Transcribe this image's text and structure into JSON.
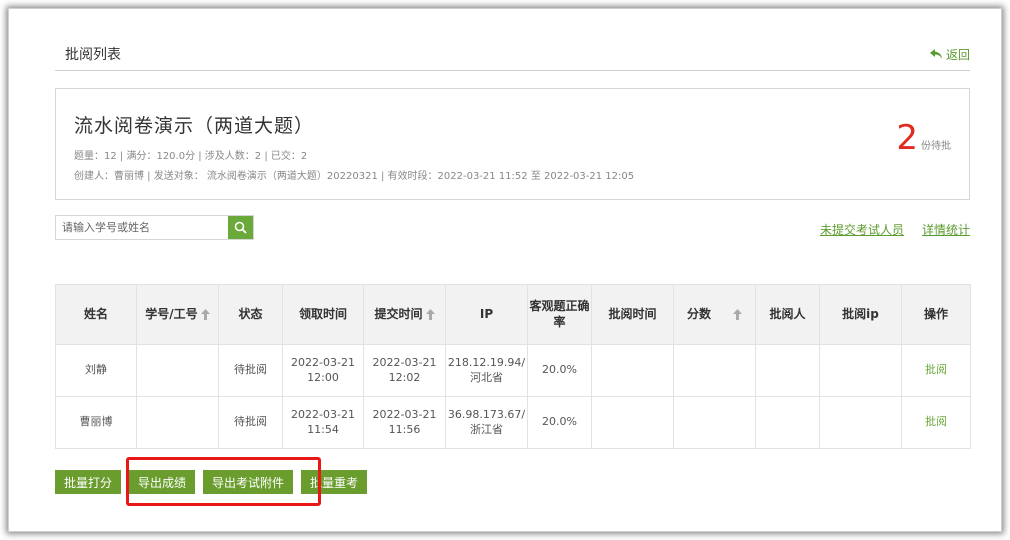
{
  "header": {
    "title": "批阅列表",
    "back_label": "返回"
  },
  "exam": {
    "title": "流水阅卷演示（两道大题）",
    "meta_line1": "题量：12 |  满分：120.0分 |  涉及人数：2 | 已交：2",
    "meta_line2": "创建人：曹丽博 | 发送对象：  流水阅卷演示（两道大题）20220321  |  有效时段：2022-03-21 11:52 至 2022-03-21 12:05",
    "pending_count": "2",
    "pending_label": "份待批"
  },
  "search": {
    "placeholder": "请输入学号或姓名"
  },
  "links": {
    "unsubmitted": "未提交考试人员",
    "details": "详情统计"
  },
  "table": {
    "headers": [
      "姓名",
      "学号/工号",
      "状态",
      "领取时间",
      "提交时间",
      "IP",
      "客观题正确率",
      "批阅时间",
      "分数",
      "批阅人",
      "批阅ip",
      "操作"
    ],
    "rows": [
      {
        "name": "刘静",
        "id": "",
        "status": "待批阅",
        "receive_date": "2022-03-21",
        "receive_time": "12:00",
        "submit_date": "2022-03-21",
        "submit_time": "12:02",
        "ip": "218.12.19.94/",
        "ip_region": "河北省",
        "accuracy": "20.0%",
        "review_time": "",
        "score": "",
        "reviewer": "",
        "reviewer_ip": "",
        "action": "批阅"
      },
      {
        "name": "曹丽博",
        "id": "",
        "status": "待批阅",
        "receive_date": "2022-03-21",
        "receive_time": "11:54",
        "submit_date": "2022-03-21",
        "submit_time": "11:56",
        "ip": "36.98.173.67/",
        "ip_region": "浙江省",
        "accuracy": "20.0%",
        "review_time": "",
        "score": "",
        "reviewer": "",
        "reviewer_ip": "",
        "action": "批阅"
      }
    ]
  },
  "actions": {
    "batch_score": "批量打分",
    "export_scores": "导出成绩",
    "export_attachments": "导出考试附件",
    "batch_retake": "批量重考"
  },
  "colors": {
    "accent_green": "#6a9d2e",
    "link_green": "#5a9b2e",
    "pending_red": "#e02b20",
    "highlight_red": "#e81818"
  }
}
